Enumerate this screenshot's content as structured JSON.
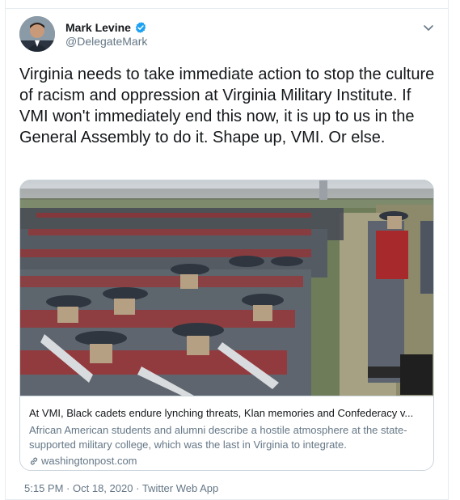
{
  "author": {
    "display_name": "Mark Levine",
    "handle": "@DelegateMark",
    "verified": true
  },
  "tweet": {
    "text": "Virginia needs to take immediate action to stop the culture of racism and oppression at Virginia Military Institute. If VMI won't immediately end this now, it is up to us in the General Assembly to do it. Shape up, VMI. Or else."
  },
  "link_card": {
    "title": "At VMI, Black cadets endure lynching threats, Klan memories and Confederacy v...",
    "description": "African American students and alumni describe a hostile atmosphere at the state-supported military college, which was the last in Virginia to integrate.",
    "domain": "washingtonpost.com"
  },
  "meta": {
    "time": "5:15 PM",
    "separator": "·",
    "date": "Oct 18, 2020",
    "source": "Twitter Web App"
  },
  "icons": {
    "verified": "verified-badge-icon",
    "caret": "chevron-down-icon",
    "link": "link-icon"
  },
  "colors": {
    "verified_blue": "#1da1f2",
    "secondary_text": "#657786",
    "border": "#e6ecf0"
  }
}
